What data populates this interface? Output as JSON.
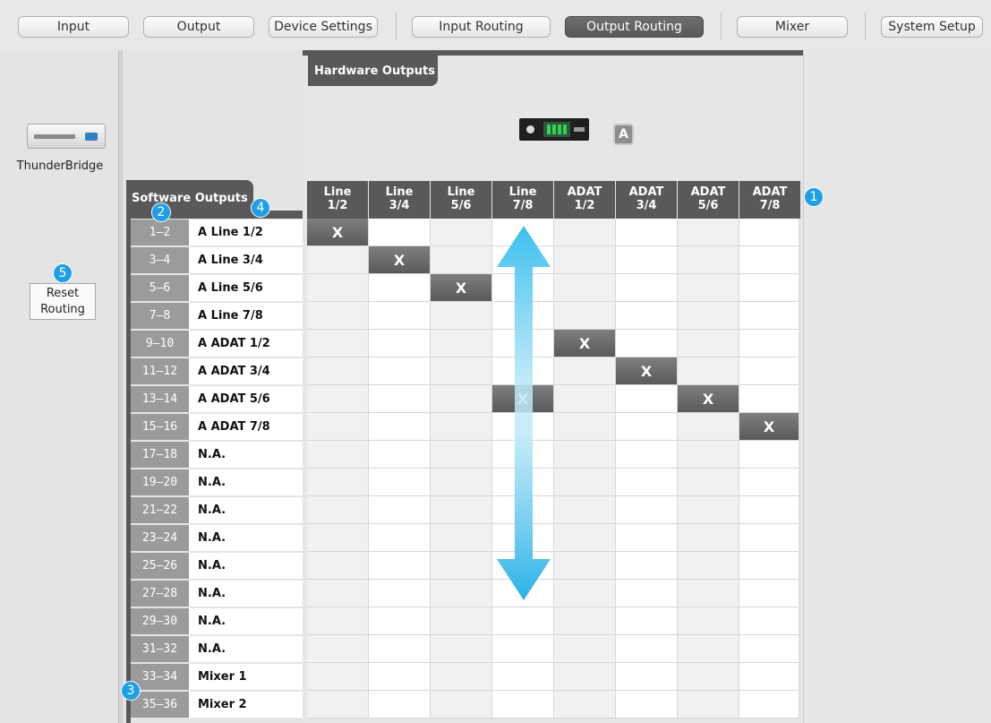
{
  "tabs": [
    {
      "label": "Input",
      "active": false
    },
    {
      "label": "Output",
      "active": false
    },
    {
      "label": "Device Settings",
      "active": false
    },
    {
      "label": "Input Routing",
      "active": false
    },
    {
      "label": "Output Routing",
      "active": true
    },
    {
      "label": "Mixer",
      "active": false
    },
    {
      "label": "System Setup",
      "active": false
    }
  ],
  "device": {
    "name": "ThunderBridge",
    "icon": "rack-device-icon"
  },
  "reset_button": "Reset\nRouting",
  "software_outputs": {
    "title": "Software Outputs",
    "rows": [
      {
        "num": "1–2",
        "name": "A Line 1/2"
      },
      {
        "num": "3–4",
        "name": "A Line 3/4"
      },
      {
        "num": "5–6",
        "name": "A Line 5/6"
      },
      {
        "num": "7–8",
        "name": "A Line 7/8"
      },
      {
        "num": "9–10",
        "name": "A ADAT 1/2"
      },
      {
        "num": "11–12",
        "name": "A ADAT 3/4"
      },
      {
        "num": "13–14",
        "name": "A ADAT 5/6"
      },
      {
        "num": "15–16",
        "name": "A ADAT 7/8"
      },
      {
        "num": "17–18",
        "name": "N.A."
      },
      {
        "num": "19–20",
        "name": "N.A."
      },
      {
        "num": "21–22",
        "name": "N.A."
      },
      {
        "num": "23–24",
        "name": "N.A."
      },
      {
        "num": "25–26",
        "name": "N.A."
      },
      {
        "num": "27–28",
        "name": "N.A."
      },
      {
        "num": "29–30",
        "name": "N.A."
      },
      {
        "num": "31–32",
        "name": "N.A."
      },
      {
        "num": "33–34",
        "name": "Mixer 1"
      },
      {
        "num": "35–36",
        "name": "Mixer 2"
      }
    ]
  },
  "hardware_outputs": {
    "title": "Hardware Outputs",
    "device_badge": "A",
    "columns": [
      "Line\n1/2",
      "Line\n3/4",
      "Line\n5/6",
      "Line\n7/8",
      "ADAT\n1/2",
      "ADAT\n3/4",
      "ADAT\n5/6",
      "ADAT\n7/8"
    ],
    "routing_mark": "X",
    "routing": [
      {
        "row": 0,
        "col": 0
      },
      {
        "row": 1,
        "col": 1
      },
      {
        "row": 2,
        "col": 2
      },
      {
        "row": 4,
        "col": 4
      },
      {
        "row": 5,
        "col": 5
      },
      {
        "row": 6,
        "col": 3
      },
      {
        "row": 6,
        "col": 6
      },
      {
        "row": 7,
        "col": 7
      }
    ]
  },
  "callouts": [
    "1",
    "2",
    "3",
    "4",
    "5"
  ],
  "colors": {
    "dark_header": "#595959",
    "active_tab": "#636363",
    "callout": "#1e9fe6",
    "arrow": "#29b4ea"
  }
}
